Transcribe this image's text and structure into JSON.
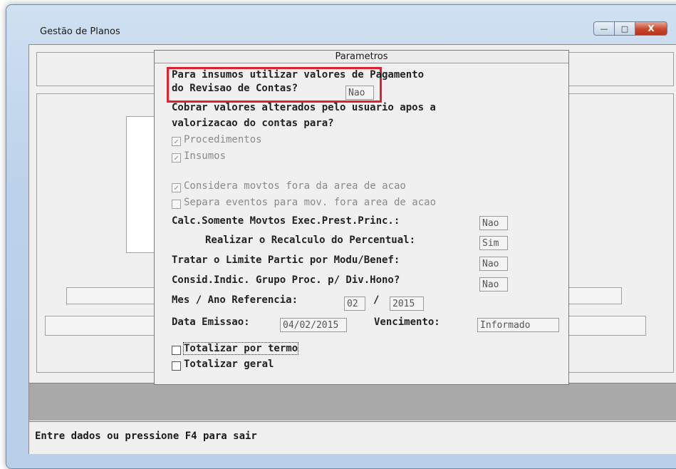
{
  "window": {
    "title": "Gestão de Planos",
    "minimize_glyph": "—",
    "maximize_glyph": "□",
    "close_glyph": "X"
  },
  "dialog": {
    "title": "Parametros",
    "insumos_line1": "Para insumos utilizar valores de Pagamento",
    "insumos_line2": "do Revisao de Contas?",
    "insumos_value": "Nao",
    "cobrar_line1": "Cobrar valores alterados pelo usuario apos a",
    "cobrar_line2": "valorizacao do contas para?",
    "procedimentos_label": "Procedimentos",
    "insumos_label": "Insumos",
    "considera_label": "Considera movtos fora da area de acao",
    "separa_label": "Separa eventos para mov. fora area de acao",
    "calc_label": "Calc.Somente Movtos Exec.Prest.Princ.:",
    "calc_value": "Nao",
    "recalc_label": "Realizar o Recalculo do Percentual:",
    "recalc_value": "Sim",
    "tratar_label": "Tratar o Limite Partic por Modu/Benef:",
    "tratar_value": "Nao",
    "consid_label": "Consid.Indic. Grupo Proc. p/ Div.Hono?",
    "consid_value": "Nao",
    "mes_ano_label": "Mes / Ano Referencia:",
    "mes_value": "02",
    "slash": "/",
    "ano_value": "2015",
    "data_emissao_label": "Data Emissao:",
    "data_emissao_value": "04/02/2015",
    "vencimento_label": "Vencimento:",
    "vencimento_value": "Informado",
    "totalizar_termo_label": "Totalizar por termo",
    "totalizar_geral_label": "Totalizar geral",
    "check_mark": "✓"
  },
  "status": {
    "message": "Entre dados ou pressione F4 para sair"
  }
}
